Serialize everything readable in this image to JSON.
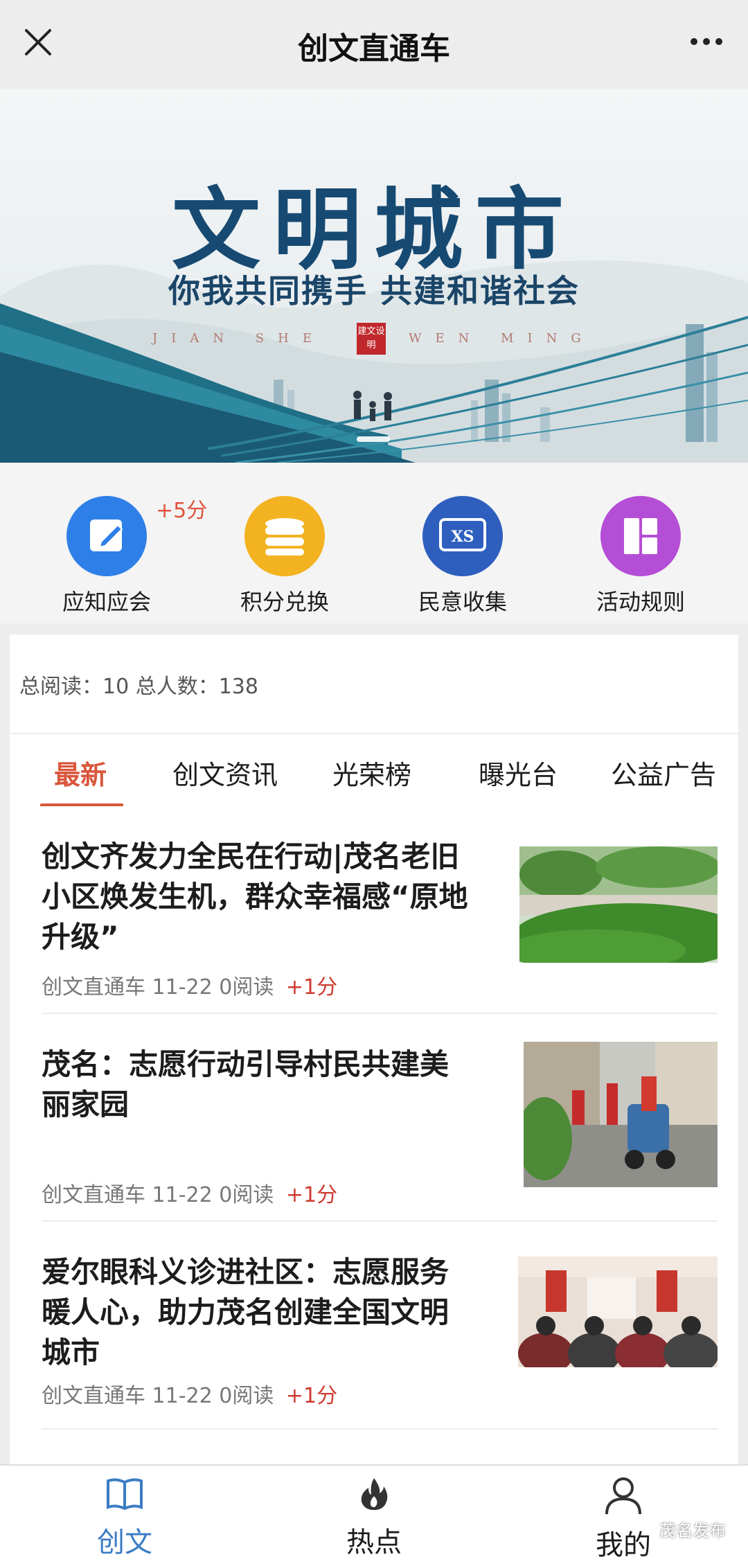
{
  "topnav": {
    "title": "创文直通车"
  },
  "banner": {
    "headline": "文明城市",
    "slogan": "你我共同携手 共建和谐社会",
    "pinyin_left": "JIAN SHE",
    "pinyin_right": "WEN MING",
    "seal": "建文设明"
  },
  "quick": {
    "items": [
      {
        "label": "应知应会",
        "icon": "edit-icon",
        "color": "#2f7fe8"
      },
      {
        "label": "积分兑换",
        "icon": "coins-icon",
        "color": "#f3b21f"
      },
      {
        "label": "民意收集",
        "icon": "xs-icon",
        "glyph": "XS",
        "color": "#2e5fbf"
      },
      {
        "label": "活动规则",
        "icon": "grid-icon",
        "color": "#b54ed6"
      }
    ],
    "badge": "+5分"
  },
  "stats": {
    "text": "总阅读：10 总人数：138"
  },
  "tabs": [
    "最新",
    "创文资讯",
    "光荣榜",
    "曝光台",
    "公益广告"
  ],
  "articles": [
    {
      "title": "创文齐发力全民在行动|茂名老旧小区焕发生机，群众幸福感“原地升级”",
      "source": "创文直通车",
      "date": "11-22",
      "reads": "0阅读",
      "points": "+1分"
    },
    {
      "title": "茂名：志愿行动引导村民共建美丽家园",
      "source": "创文直通车",
      "date": "11-22",
      "reads": "0阅读",
      "points": "+1分"
    },
    {
      "title": "爱尔眼科义诊进社区：志愿服务暖人心，助力茂名创建全国文明城市",
      "source": "创文直通车",
      "date": "11-22",
      "reads": "0阅读",
      "points": "+1分"
    }
  ],
  "bottombar": {
    "items": [
      {
        "label": "创文",
        "icon": "book-icon"
      },
      {
        "label": "热点",
        "icon": "flame-icon"
      },
      {
        "label": "我的",
        "icon": "person-icon"
      }
    ]
  },
  "watermark": "茂名发布",
  "colors": {
    "accent": "#d9563c",
    "points": "#cf3b2f",
    "nav_active": "#3b7cc4"
  }
}
